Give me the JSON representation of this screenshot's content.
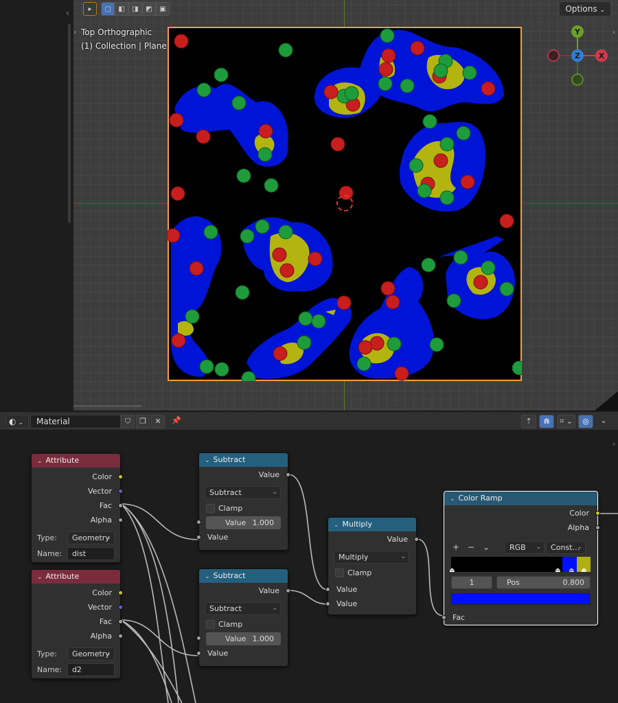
{
  "viewport": {
    "view_name": "Top Orthographic",
    "collection_label": "(1) Collection | Plane",
    "options_label": "Options",
    "gizmo": {
      "x": "X",
      "y": "Y",
      "z": "Z"
    }
  },
  "node_editor_header": {
    "material_name": "Material"
  },
  "nodes": {
    "attr1": {
      "title": "Attribute",
      "outputs": [
        "Color",
        "Vector",
        "Fac",
        "Alpha"
      ],
      "type_label": "Type:",
      "type_value": "Geometry",
      "name_label": "Name:",
      "name_value": "dist"
    },
    "attr2": {
      "title": "Attribute",
      "outputs": [
        "Color",
        "Vector",
        "Fac",
        "Alpha"
      ],
      "type_label": "Type:",
      "type_value": "Geometry",
      "name_label": "Name:",
      "name_value": "d2"
    },
    "sub1": {
      "title": "Subtract",
      "output": "Value",
      "operation": "Subtract",
      "clamp_label": "Clamp",
      "value_label": "Value",
      "value_number": "1.000",
      "input": "Value"
    },
    "sub2": {
      "title": "Subtract",
      "output": "Value",
      "operation": "Subtract",
      "clamp_label": "Clamp",
      "value_label": "Value",
      "value_number": "1.000",
      "input": "Value"
    },
    "mult": {
      "title": "Multiply",
      "output": "Value",
      "operation": "Multiply",
      "clamp_label": "Clamp",
      "input1": "Value",
      "input2": "Value"
    },
    "ramp": {
      "title": "Color Ramp",
      "outputs": [
        "Color",
        "Alpha"
      ],
      "color_mode": "RGB",
      "interpolation": "Const…",
      "active_stop_index": "1",
      "pos_label": "Pos",
      "pos_value": "0.800",
      "input": "Fac",
      "active_color": "#0010ff",
      "ramp_colors": [
        "#000000",
        "#0010ff",
        "#b0b010"
      ]
    }
  },
  "colors": {
    "attribute_header": "#7a2c3d",
    "math_header": "#24607e",
    "plane_outline": "#f5a040",
    "blob_blue": "#0014d8",
    "blob_yellow": "#b4b410",
    "sphere_red": "#c81e1e",
    "sphere_green": "#1e9c3c"
  }
}
